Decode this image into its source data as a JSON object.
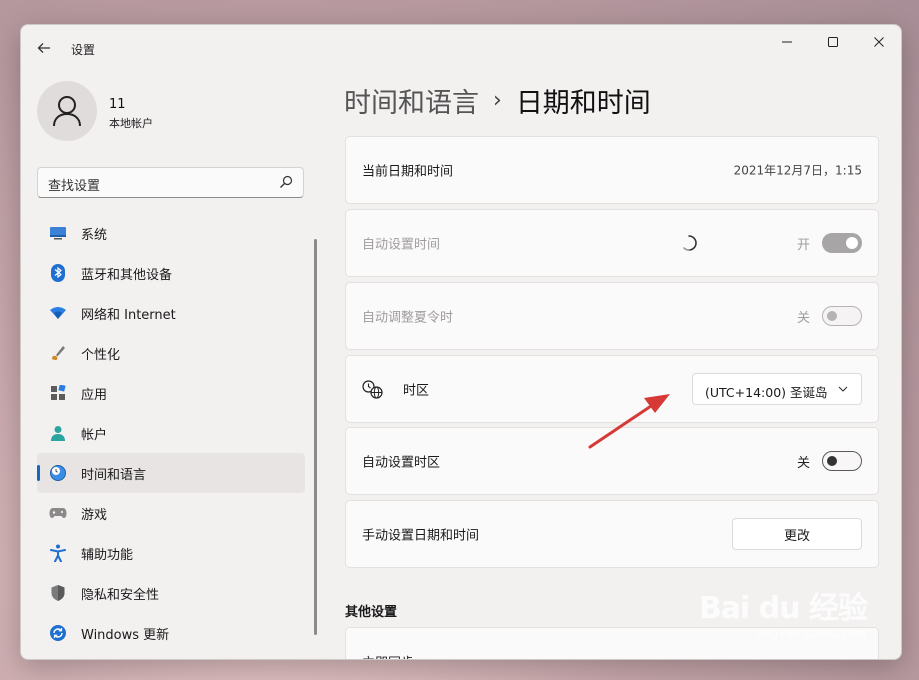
{
  "window": {
    "title": "设置",
    "controls": {
      "minimize": "—",
      "maximize": "☐",
      "close": "✕"
    }
  },
  "user": {
    "name": "11",
    "subtitle": "本地帐户"
  },
  "search": {
    "placeholder": "查找设置"
  },
  "sidebar": {
    "items": [
      {
        "label": "系统",
        "icon": "monitor-icon"
      },
      {
        "label": "蓝牙和其他设备",
        "icon": "bluetooth-icon"
      },
      {
        "label": "网络和 Internet",
        "icon": "wifi-icon"
      },
      {
        "label": "个性化",
        "icon": "brush-icon"
      },
      {
        "label": "应用",
        "icon": "apps-icon"
      },
      {
        "label": "帐户",
        "icon": "account-icon"
      },
      {
        "label": "时间和语言",
        "icon": "globe-clock-icon",
        "active": true
      },
      {
        "label": "游戏",
        "icon": "gamepad-icon"
      },
      {
        "label": "辅助功能",
        "icon": "accessibility-icon"
      },
      {
        "label": "隐私和安全性",
        "icon": "shield-icon"
      },
      {
        "label": "Windows 更新",
        "icon": "update-icon"
      }
    ]
  },
  "breadcrumb": {
    "parent": "时间和语言",
    "separator": "›",
    "current": "日期和时间"
  },
  "settings": {
    "current_datetime": {
      "label": "当前日期和时间",
      "value": "2021年12月7日，1:15"
    },
    "auto_time": {
      "label": "自动设置时间",
      "state_text": "开",
      "on": true,
      "disabled": true
    },
    "auto_dst": {
      "label": "自动调整夏令时",
      "state_text": "关",
      "on": false,
      "disabled": true
    },
    "timezone": {
      "label": "时区",
      "value": "(UTC+14:00) 圣诞岛"
    },
    "auto_timezone": {
      "label": "自动设置时区",
      "state_text": "关",
      "on": false
    },
    "manual": {
      "label": "手动设置日期和时间",
      "button": "更改"
    }
  },
  "other_settings": {
    "title": "其他设置",
    "sync": {
      "label": "立即同步"
    }
  },
  "watermark": {
    "brand": "Bai du 经验",
    "url": "jingyan.baidu.com"
  },
  "colors": {
    "accent": "#1a67c0",
    "annotation_arrow": "#d63a36"
  }
}
